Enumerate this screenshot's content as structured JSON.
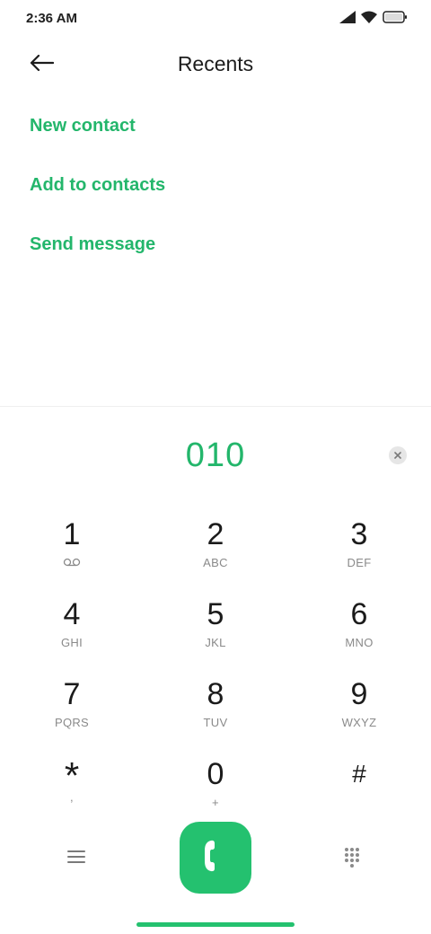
{
  "status_bar": {
    "time": "2:36 AM",
    "icons": [
      "signal-icon",
      "wifi-icon",
      "battery-icon"
    ]
  },
  "header": {
    "title": "Recents",
    "back_icon": "back-arrow-icon"
  },
  "actions": [
    {
      "label": "New contact"
    },
    {
      "label": "Add to contacts"
    },
    {
      "label": "Send message"
    }
  ],
  "dialer": {
    "number": "010",
    "clear_icon": "clear-icon"
  },
  "keypad": {
    "keys": [
      {
        "digit": "1",
        "letters": ""
      },
      {
        "digit": "2",
        "letters": "ABC"
      },
      {
        "digit": "3",
        "letters": "DEF"
      },
      {
        "digit": "4",
        "letters": "GHI"
      },
      {
        "digit": "5",
        "letters": "JKL"
      },
      {
        "digit": "6",
        "letters": "MNO"
      },
      {
        "digit": "7",
        "letters": "PQRS"
      },
      {
        "digit": "8",
        "letters": "TUV"
      },
      {
        "digit": "9",
        "letters": "WXYZ"
      },
      {
        "digit": "*",
        "letters": ","
      },
      {
        "digit": "0",
        "letters": "+"
      },
      {
        "digit": "#",
        "letters": ""
      }
    ]
  },
  "bottom_bar": {
    "menu_icon": "menu-icon",
    "call_icon": "phone-icon",
    "dialpad_icon": "dialpad-icon"
  },
  "colors": {
    "accent": "#23b66b",
    "call_button": "#24c16f"
  }
}
